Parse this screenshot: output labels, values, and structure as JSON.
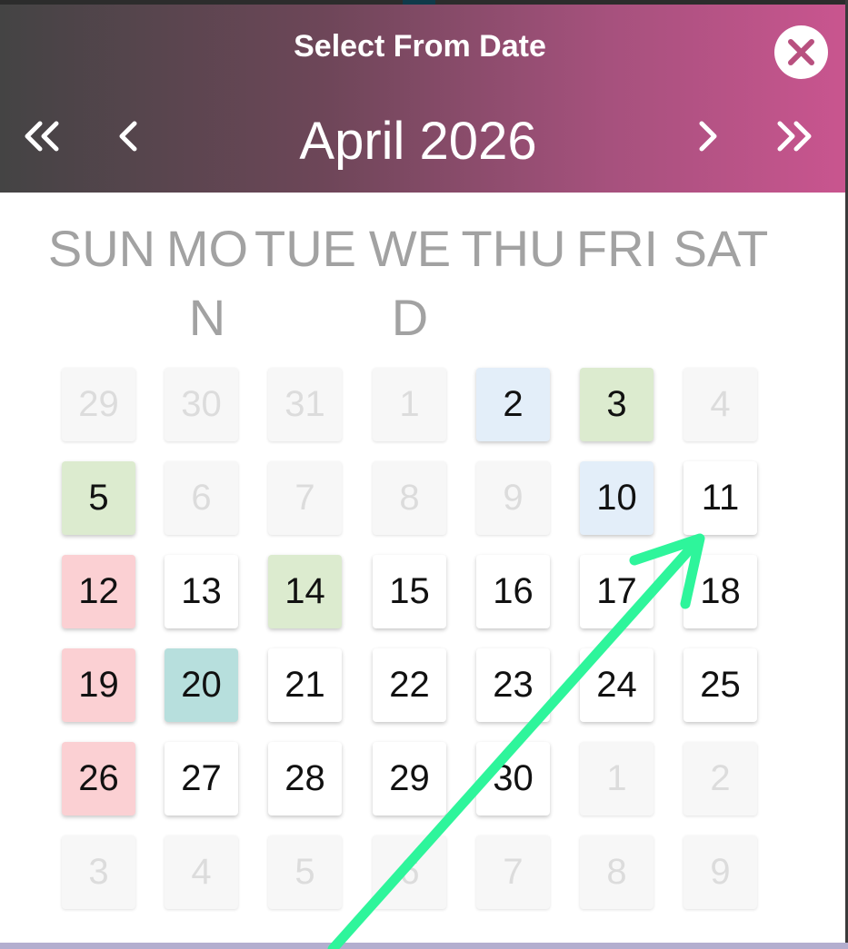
{
  "header": {
    "title": "Select From Date",
    "month_label": "April 2026",
    "nav": {
      "prev_year_icon": "double-chevron-left-icon",
      "prev_month_icon": "chevron-left-icon",
      "next_month_icon": "chevron-right-icon",
      "next_year_icon": "double-chevron-right-icon"
    },
    "close_icon": "close-icon",
    "gradient_colors": [
      "#444444",
      "#c9558f"
    ]
  },
  "weekdays": [
    "SUN",
    "MON",
    "TUE",
    "WED",
    "THU",
    "FRI",
    "SAT"
  ],
  "status_colors": {
    "blue": "#e3eef9",
    "green": "#dcebcf",
    "pink": "#fbd0d3",
    "teal": "#b7dfdd",
    "muted_text": "#dcdcdc"
  },
  "weeks": [
    [
      {
        "label": "29",
        "state": "muted"
      },
      {
        "label": "30",
        "state": "muted"
      },
      {
        "label": "31",
        "state": "muted"
      },
      {
        "label": "1",
        "state": "muted"
      },
      {
        "label": "2",
        "state": "blue"
      },
      {
        "label": "3",
        "state": "green"
      },
      {
        "label": "4",
        "state": "muted"
      }
    ],
    [
      {
        "label": "5",
        "state": "green"
      },
      {
        "label": "6",
        "state": "muted"
      },
      {
        "label": "7",
        "state": "muted"
      },
      {
        "label": "8",
        "state": "muted"
      },
      {
        "label": "9",
        "state": "muted"
      },
      {
        "label": "10",
        "state": "blue"
      },
      {
        "label": "11",
        "state": "normal"
      }
    ],
    [
      {
        "label": "12",
        "state": "pink"
      },
      {
        "label": "13",
        "state": "normal"
      },
      {
        "label": "14",
        "state": "green"
      },
      {
        "label": "15",
        "state": "normal"
      },
      {
        "label": "16",
        "state": "normal"
      },
      {
        "label": "17",
        "state": "normal"
      },
      {
        "label": "18",
        "state": "normal"
      }
    ],
    [
      {
        "label": "19",
        "state": "pink"
      },
      {
        "label": "20",
        "state": "teal"
      },
      {
        "label": "21",
        "state": "normal"
      },
      {
        "label": "22",
        "state": "normal"
      },
      {
        "label": "23",
        "state": "normal"
      },
      {
        "label": "24",
        "state": "normal"
      },
      {
        "label": "25",
        "state": "normal"
      }
    ],
    [
      {
        "label": "26",
        "state": "pink"
      },
      {
        "label": "27",
        "state": "normal"
      },
      {
        "label": "28",
        "state": "normal"
      },
      {
        "label": "29",
        "state": "normal"
      },
      {
        "label": "30",
        "state": "normal"
      },
      {
        "label": "1",
        "state": "muted"
      },
      {
        "label": "2",
        "state": "muted"
      }
    ],
    [
      {
        "label": "3",
        "state": "muted"
      },
      {
        "label": "4",
        "state": "muted"
      },
      {
        "label": "5",
        "state": "muted"
      },
      {
        "label": "6",
        "state": "muted"
      },
      {
        "label": "7",
        "state": "muted"
      },
      {
        "label": "8",
        "state": "muted"
      },
      {
        "label": "9",
        "state": "muted"
      }
    ]
  ],
  "annotation": {
    "icon": "arrow-annotation-icon",
    "color": "#2ef59b"
  }
}
